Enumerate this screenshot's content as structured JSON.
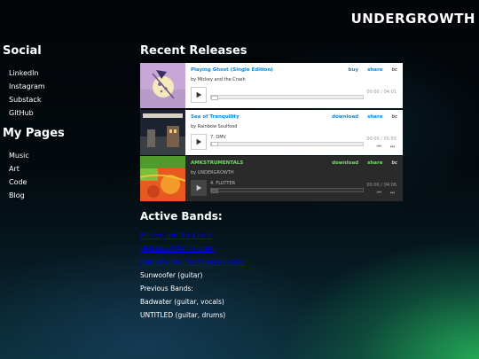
{
  "site": {
    "title": "UNDERGROWTH"
  },
  "sidebar": {
    "social_heading": "Social",
    "social": [
      "LinkedIn",
      "Instagram",
      "Substack",
      "GitHub"
    ],
    "pages_heading": "My Pages",
    "pages": [
      "Music",
      "Art",
      "Code",
      "Blog"
    ]
  },
  "releases": {
    "heading": "Recent Releases",
    "players": [
      {
        "title": "Playing Ghost (Single Edition)",
        "by": "by Mickey and the Crash",
        "action": "buy",
        "share": "share",
        "bc": "bc",
        "track": "",
        "time": "00:00 / 04:01",
        "theme": "light",
        "art_color": "#c8a7d6"
      },
      {
        "title": "Sea of Tranquility",
        "by": "by Rainbow Soulfood",
        "action": "download",
        "share": "share",
        "bc": "bc",
        "track": "7.  DMV",
        "time": "00:00 / 05:55",
        "theme": "light",
        "art_color": "#2a2f3a"
      },
      {
        "title": "AMKSTRUMENTALS",
        "by": "by UNDERGROWTH",
        "action": "download",
        "share": "share",
        "bc": "bc",
        "track": "4.  FLUTTER",
        "time": "00:00 / 04:06",
        "theme": "dark",
        "art_color": "#e85a1f"
      }
    ]
  },
  "bands": {
    "heading": "Active Bands:",
    "links": [
      "Mickey and the Crash",
      "UNDERGROWTH (solo)",
      "Rainbow Soulfood (bass/vocals)"
    ],
    "entries": [
      "Sunwoofer (guitar)",
      "Previous Bands:",
      "Badwater (guitar, vocals)",
      "UNTITLED (guitar, drums)"
    ]
  }
}
